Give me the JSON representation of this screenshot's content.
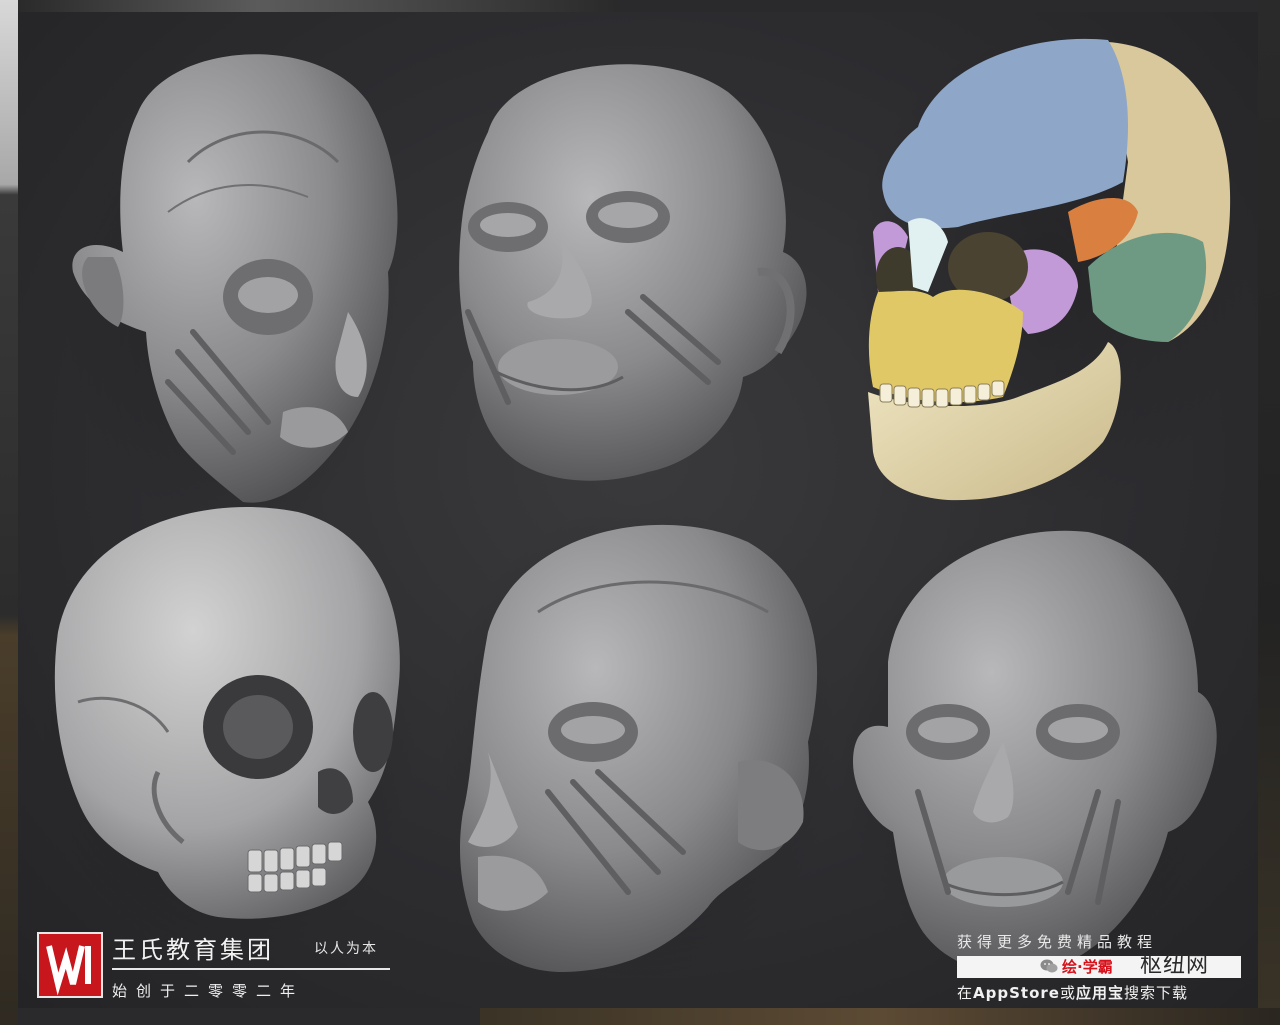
{
  "brand": {
    "name": "王氏教育集团",
    "motto": "以人为本",
    "since": "始创于二零零二年",
    "logo_mark": "W"
  },
  "promo": {
    "line1": "获得更多免费精品教程",
    "wechat_label": "绘",
    "brand_label": "学霸",
    "site_label": "枢纽网",
    "line2_prefix": "在",
    "line2_store": "AppStore",
    "line2_mid": "或",
    "line2_app": "应用宝",
    "line2_suffix": "搜索下载"
  },
  "palette": {
    "background": "#2a2a2c",
    "sculpt_grey": "#8f8f90",
    "skull_frontal": "#8fa6c6",
    "skull_parietal": "#d8c79a",
    "skull_maxilla": "#e0c765",
    "skull_zygomatic": "#c49ad8",
    "skull_temporal": "#6d9a82",
    "skull_sphenoid": "#d9803f",
    "skull_mandible": "#e7dbaf",
    "logo_red": "#c8161d"
  },
  "images": [
    {
      "name": "muscle-head-three-quarter-right",
      "kind": "flayed-head-sculpt",
      "color": "grey"
    },
    {
      "name": "muscle-head-front-tilted",
      "kind": "flayed-head-sculpt",
      "color": "grey"
    },
    {
      "name": "skull-colored-bones",
      "kind": "skull-sculpt",
      "color": "multicolor"
    },
    {
      "name": "skull-grey",
      "kind": "skull-sculpt",
      "color": "grey"
    },
    {
      "name": "muscle-head-three-quarter-left",
      "kind": "flayed-head-sculpt",
      "color": "grey"
    },
    {
      "name": "muscle-head-front",
      "kind": "flayed-head-sculpt",
      "color": "grey"
    }
  ]
}
